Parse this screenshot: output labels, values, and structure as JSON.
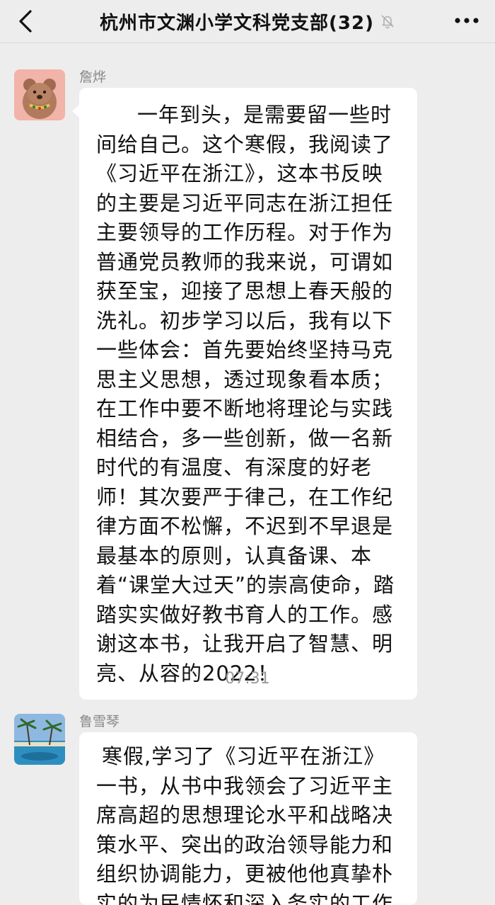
{
  "header": {
    "title": "杭州市文渊小学文科党支部(32)",
    "back_icon": "chevron-left-icon",
    "mute_icon": "bell-off-icon",
    "more_icon": "more-dots-icon"
  },
  "messages": [
    {
      "sender": "詹烨",
      "avatar": "bear-avatar",
      "text": "一年到头，是需要留一些时间给自己。这个寒假，我阅读了《习近平在浙江》，这本书反映的主要是习近平同志在浙江担任主要领导的工作历程。对于作为普通党员教师的我来说，可谓如获至宝，迎接了思想上春天般的洗礼。初步学习以后，我有以下一些体会：首先要始终坚持马克思主义思想，透过现象看本质；在工作中要不断地将理论与实践相结合，多一些创新，做一名新时代的有温度、有深度的好老师！其次要严于律己，在工作纪律方面不松懈，不迟到不早退是最基本的原则，认真备课、本着“课堂大过天”的崇高使命，踏踏实实做好教书育人的工作。感谢这本书，让我开启了智慧、明亮、从容的2022！"
    },
    {
      "sender": "鲁雪琴",
      "avatar": "beach-palm-avatar",
      "text": "寒假,学习了《习近平在浙江》一书，从书中我领会了习近平主席高超的思想理论水平和战略决策水平、突出的政治领导能力和组织协调能力，更被他他真挚朴实的为民情怀和深入务实的工作"
    }
  ],
  "timestamp": "07:31",
  "colors": {
    "background": "#ededed",
    "bubble": "#ffffff",
    "sender_text": "#888888",
    "timestamp_text": "#9a9a9a"
  }
}
